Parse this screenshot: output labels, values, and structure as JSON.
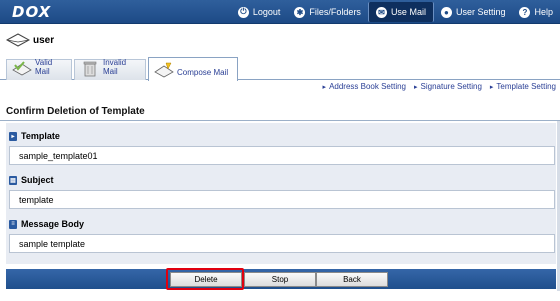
{
  "header": {
    "logo": "DOX",
    "nav": [
      {
        "label": "Logout",
        "icon": "logout-icon",
        "active": false
      },
      {
        "label": "Files/Folders",
        "icon": "files-icon",
        "active": false
      },
      {
        "label": "Use Mail",
        "icon": "mail-icon",
        "active": true
      },
      {
        "label": "User Setting",
        "icon": "user-icon",
        "active": false
      },
      {
        "label": "Help",
        "icon": "help-icon",
        "active": false
      }
    ]
  },
  "user": {
    "name": "user",
    "icon": "envelope-icon"
  },
  "tabs": [
    {
      "label": "Valid Mail",
      "icon": "valid-mail-icon"
    },
    {
      "label": "Invalid Mail",
      "icon": "trash-icon"
    },
    {
      "label": "Compose Mail",
      "icon": "compose-icon",
      "active": true
    }
  ],
  "links": [
    {
      "label": "Address Book Setting"
    },
    {
      "label": "Signature Setting"
    },
    {
      "label": "Template Setting"
    }
  ],
  "page_title": "Confirm Deletion of Template",
  "fields": [
    {
      "label": "Template",
      "value": "sample_template01"
    },
    {
      "label": "Subject",
      "value": "template"
    },
    {
      "label": "Message Body",
      "value": "sample template"
    }
  ],
  "buttons": {
    "delete": "Delete",
    "stop": "Stop",
    "back": "Back"
  },
  "colors": {
    "header": "#1d4a86",
    "highlight": "#e00010",
    "link": "#2a3f95"
  }
}
